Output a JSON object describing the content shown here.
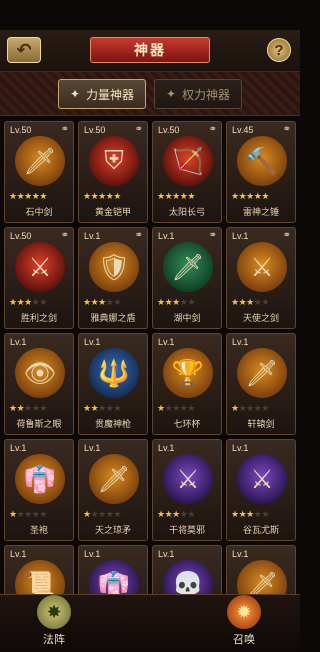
{
  "header": {
    "title": "神器",
    "back_icon": "↶",
    "help_icon": "?"
  },
  "tabs": [
    {
      "label": "力量神器",
      "icon": "✦",
      "active": true
    },
    {
      "label": "权力神器",
      "icon": "✦",
      "active": false
    }
  ],
  "artifacts": [
    {
      "level": "Lv.50",
      "name": "石中剑",
      "stars": 5,
      "orb": "gold",
      "icon": "🗡",
      "linked": true
    },
    {
      "level": "Lv.50",
      "name": "黄金铠甲",
      "stars": 5,
      "orb": "red",
      "icon": "⛨",
      "linked": true
    },
    {
      "level": "Lv.50",
      "name": "太阳长弓",
      "stars": 5,
      "orb": "red",
      "icon": "🏹",
      "linked": true
    },
    {
      "level": "Lv.45",
      "name": "雷神之锤",
      "stars": 5,
      "orb": "gold",
      "icon": "🔨",
      "linked": true
    },
    {
      "level": "Lv.50",
      "name": "胜利之剑",
      "stars": 3,
      "orb": "red",
      "icon": "⚔",
      "linked": true
    },
    {
      "level": "Lv.1",
      "name": "雅典娜之盾",
      "stars": 3,
      "orb": "gold",
      "icon": "🛡",
      "linked": true
    },
    {
      "level": "Lv.1",
      "name": "湖中剑",
      "stars": 3,
      "orb": "green",
      "icon": "🗡",
      "linked": true
    },
    {
      "level": "Lv.1",
      "name": "天使之剑",
      "stars": 3,
      "orb": "gold",
      "icon": "⚔",
      "linked": true
    },
    {
      "level": "Lv.1",
      "name": "荷鲁斯之眼",
      "stars": 2,
      "orb": "gold",
      "icon": "👁",
      "linked": false
    },
    {
      "level": "Lv.1",
      "name": "贯魔神枪",
      "stars": 2,
      "orb": "blue",
      "icon": "🔱",
      "linked": false
    },
    {
      "level": "Lv.1",
      "name": "七环杯",
      "stars": 1,
      "orb": "gold",
      "icon": "🏆",
      "linked": false
    },
    {
      "level": "Lv.1",
      "name": "轩辕剑",
      "stars": 1,
      "orb": "gold",
      "icon": "🗡",
      "linked": false
    },
    {
      "level": "Lv.1",
      "name": "圣袍",
      "stars": 1,
      "orb": "gold",
      "icon": "👘",
      "linked": false
    },
    {
      "level": "Lv.1",
      "name": "天之琼矛",
      "stars": 1,
      "orb": "gold",
      "icon": "🗡",
      "linked": false
    },
    {
      "level": "Lv.1",
      "name": "干将莫邪",
      "stars": 3,
      "orb": "purple",
      "icon": "⚔",
      "linked": false
    },
    {
      "level": "Lv.1",
      "name": "谷瓦尤斯",
      "stars": 3,
      "orb": "purple",
      "icon": "⚔",
      "linked": false
    },
    {
      "level": "Lv.1",
      "name": "",
      "stars": 0,
      "orb": "gold",
      "icon": "📜",
      "linked": false
    },
    {
      "level": "Lv.1",
      "name": "",
      "stars": 0,
      "orb": "purple",
      "icon": "👘",
      "linked": false
    },
    {
      "level": "Lv.1",
      "name": "",
      "stars": 0,
      "orb": "purple",
      "icon": "💀",
      "linked": false
    },
    {
      "level": "Lv.1",
      "name": "",
      "stars": 0,
      "orb": "gold",
      "icon": "🗡",
      "linked": false
    }
  ],
  "bottom": [
    {
      "label": "法阵",
      "icon": "✸"
    },
    {
      "label": "召唤",
      "icon": "✹"
    }
  ],
  "link_icon": "⚭",
  "star_icon": "★"
}
